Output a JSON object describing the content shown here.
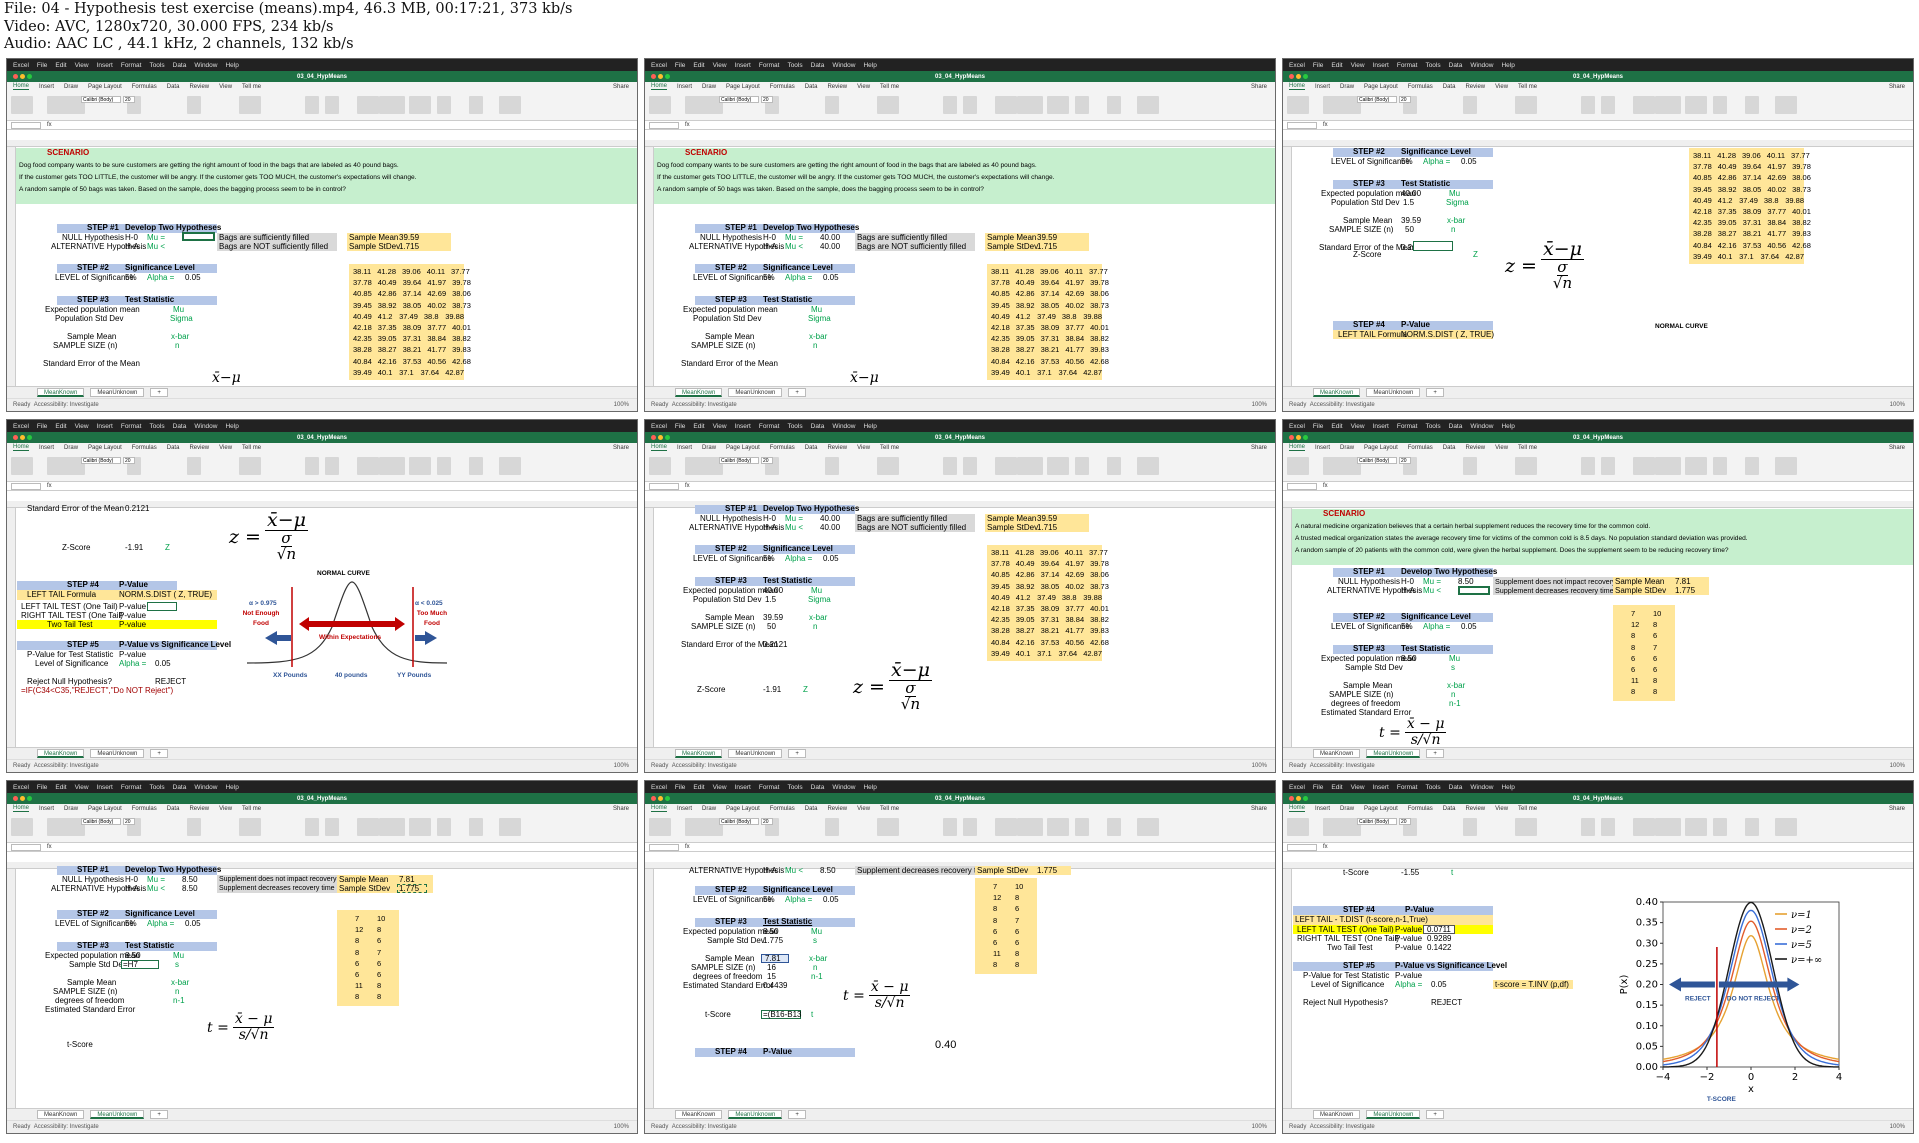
{
  "header": {
    "file": "File: 04 - Hypothesis test exercise (means).mp4, 46.3 MB, 00:17:21, 373 kb/s",
    "video": "Video: AVC, 1280x720, 30.000 FPS, 234 kb/s",
    "audio": "Audio: AAC LC , 44.1 kHz, 2 channels, 132 kb/s"
  },
  "app": {
    "menu": [
      "Excel",
      "File",
      "Edit",
      "View",
      "Insert",
      "Format",
      "Tools",
      "Data",
      "Window",
      "Help"
    ],
    "doc_name": "03_04_HypMeans",
    "ribbon_tabs": [
      "Home",
      "Insert",
      "Draw",
      "Page Layout",
      "Formulas",
      "Data",
      "Review",
      "View",
      "Tell me"
    ],
    "share": "Share",
    "font_name": "Calibri (Body)",
    "font_size": "20",
    "sheets": [
      "MeanKnown",
      "MeanUnknown"
    ],
    "status_ready": "Ready",
    "status_acc": "Accessibility: Investigate",
    "zoom": "100%"
  },
  "scenario1": {
    "title": "SCENARIO",
    "line1": "Dog food company wants to be sure customers are getting the right amount of food in the bags that are labeled as 40 pound bags.",
    "line2": "If the customer gets TOO LITTLE, the customer will be angry. If the customer gets TOO MUCH, the customer's expectations will change.",
    "line3": "A random sample of 50 bags was taken. Based on the sample, does the bagging process seem to be in control?"
  },
  "labels": {
    "step1": "STEP #1",
    "develop": "Develop Two Hypotheses",
    "null": "NULL Hypothesis",
    "alt": "ALTERNATIVE Hypothesis",
    "h0": "H-0",
    "ha": "H-A",
    "mu_eq": "Mu =",
    "mu_lt": "Mu <",
    "suff": "Bags are sufficiently filled",
    "notsuff": "Bags are NOT sufficiently filled",
    "step2": "STEP #2",
    "sig": "Significance Level",
    "los": "LEVEL of Significance",
    "pct5": "5%",
    "alpha": "Alpha =",
    "alpha_val": "0.05",
    "step3": "STEP #3",
    "test": "Test Statistic",
    "epm": "Expected population mean",
    "psd": "Population Std Dev",
    "ssd": "Sample Std Dev",
    "mu": "Mu",
    "sigma": "Sigma",
    "s": "s",
    "smean": "Sample Mean",
    "ssize": "SAMPLE SIZE (n)",
    "xbar": "x-bar",
    "n": "n",
    "dof": "degrees of freedom",
    "nm1": "n-1",
    "se": "Standard Error of the Mean",
    "ese": "Estimated Standard Error",
    "zscore": "Z-Score",
    "z": "Z",
    "tscore": "t-Score",
    "t": "t",
    "step4": "STEP #4",
    "pval": "P-Value",
    "ltf": "LEFT TAIL Formula",
    "normsdist": "NORM.S.DIST ( Z, TRUE)",
    "ltt": "LEFT TAIL TEST (One Tail)",
    "rtt": "RIGHT TAIL TEST (One Tail)",
    "twt": "Two Tail Test",
    "pvalue": "P-value",
    "step5": "STEP #5",
    "pvs": "P-Value vs Significance Level",
    "pvt": "P-Value for Test Statistic",
    "los2": "Level of Significance",
    "reject_q": "Reject Null Hypothesis?",
    "reject": "REJECT",
    "formula_if": "=IF(C34<C35,\"REJECT\",\"Do NOT Reject\")",
    "smean_lbl": "Sample Mean",
    "sstd_lbl": "Sample StDev",
    "normal_curve": "NORMAL CURVE",
    "ltdist": "LEFT TAIL - T.DIST (t-score,n-1,True)",
    "tinv": "t-score = T.INV (p,df)",
    "supp_no": "Supplement does not impact recovery time",
    "supp_dec": "Supplement decreases recovery time"
  },
  "values": {
    "forty": "40.00",
    "sm": "39.59",
    "ssd": "1.715",
    "pop_sd": "1.5",
    "ss": "50",
    "se": "0.2121",
    "z": "-1.91",
    "s2_mu": "8.50",
    "s2_mean": "7.81",
    "s2_sd": "1.775",
    "s2_n": "16",
    "s2_df": "15",
    "s2_ese": "0.4439",
    "s2_t": "-1.55",
    "p_left": "0.0711",
    "p_right": "0.9289",
    "p_two": "0.1422",
    "cell_h7": "=H7",
    "formula_t": "=(B16-B13",
    "t_cut": "0.40"
  },
  "scenario2": {
    "title": "SCENARIO",
    "line1": "A natural medicine organization believes that a certain herbal supplement reduces the recovery time for the common cold.",
    "line2": "A trusted medical organization states the average recovery time for victims of the common cold is 8.5 days. No population standard deviation was provided.",
    "line3": "A random sample of 20 patients with the common cold, were given the herbal supplement. Does the supplement seem to be reducing recovery time?"
  },
  "dog_data": [
    [
      "38.11",
      "41.28",
      "39.06",
      "40.11",
      "37.77"
    ],
    [
      "37.78",
      "40.49",
      "39.64",
      "41.97",
      "39.78"
    ],
    [
      "40.85",
      "42.86",
      "37.14",
      "42.69",
      "38.06"
    ],
    [
      "39.45",
      "38.92",
      "38.05",
      "40.02",
      "38.73"
    ],
    [
      "40.49",
      "41.2",
      "37.49",
      "38.8",
      "39.88"
    ],
    [
      "42.18",
      "37.35",
      "38.09",
      "37.77",
      "40.01"
    ],
    [
      "42.35",
      "39.05",
      "37.31",
      "38.84",
      "38.82"
    ],
    [
      "38.28",
      "38.27",
      "38.21",
      "41.77",
      "39.83"
    ],
    [
      "40.84",
      "42.16",
      "37.53",
      "40.56",
      "42.68"
    ],
    [
      "39.49",
      "40.1",
      "37.1",
      "37.64",
      "42.87"
    ]
  ],
  "supp_data": [
    [
      "7",
      "10"
    ],
    [
      "12",
      "8"
    ],
    [
      "8",
      "6"
    ],
    [
      "8",
      "7"
    ],
    [
      "6",
      "6"
    ],
    [
      "6",
      "6"
    ],
    [
      "11",
      "8"
    ],
    [
      "8",
      "8"
    ]
  ],
  "normal_chart": {
    "title": "NORMAL CURVE",
    "left_alpha": "α > 0.975",
    "right_alpha": "α < 0.025",
    "left_label": "Not Enough Food",
    "right_label": "Too Much Food",
    "center_label": "Within Expectations",
    "x_labels": [
      "XX Pounds",
      "40 pounds",
      "YY Pounds"
    ],
    "colors": {
      "arrow_red": "#c00000",
      "arrow_blue": "#2f5597",
      "curve": "#333333"
    }
  },
  "t_chart": {
    "type": "line",
    "xlabel": "x",
    "ylabel": "P(x)",
    "xlim": [
      -4,
      4
    ],
    "ylim": [
      0.0,
      0.4
    ],
    "x_ticks": [
      "−4",
      "−2",
      "0",
      "2",
      "4"
    ],
    "y_ticks": [
      "0.00",
      "0.05",
      "0.10",
      "0.15",
      "0.20",
      "0.25",
      "0.30",
      "0.35",
      "0.40"
    ],
    "legend": [
      "ν=1",
      "ν=2",
      "ν=5",
      "ν=+∞"
    ],
    "colors": [
      "#e6a232",
      "#e25d2c",
      "#3a6fd8",
      "#1a1a1a"
    ],
    "df": [
      1,
      2,
      5,
      1000
    ],
    "reject": "REJECT",
    "not_reject": "DO NOT REJECT",
    "tscore": "T-SCORE"
  }
}
